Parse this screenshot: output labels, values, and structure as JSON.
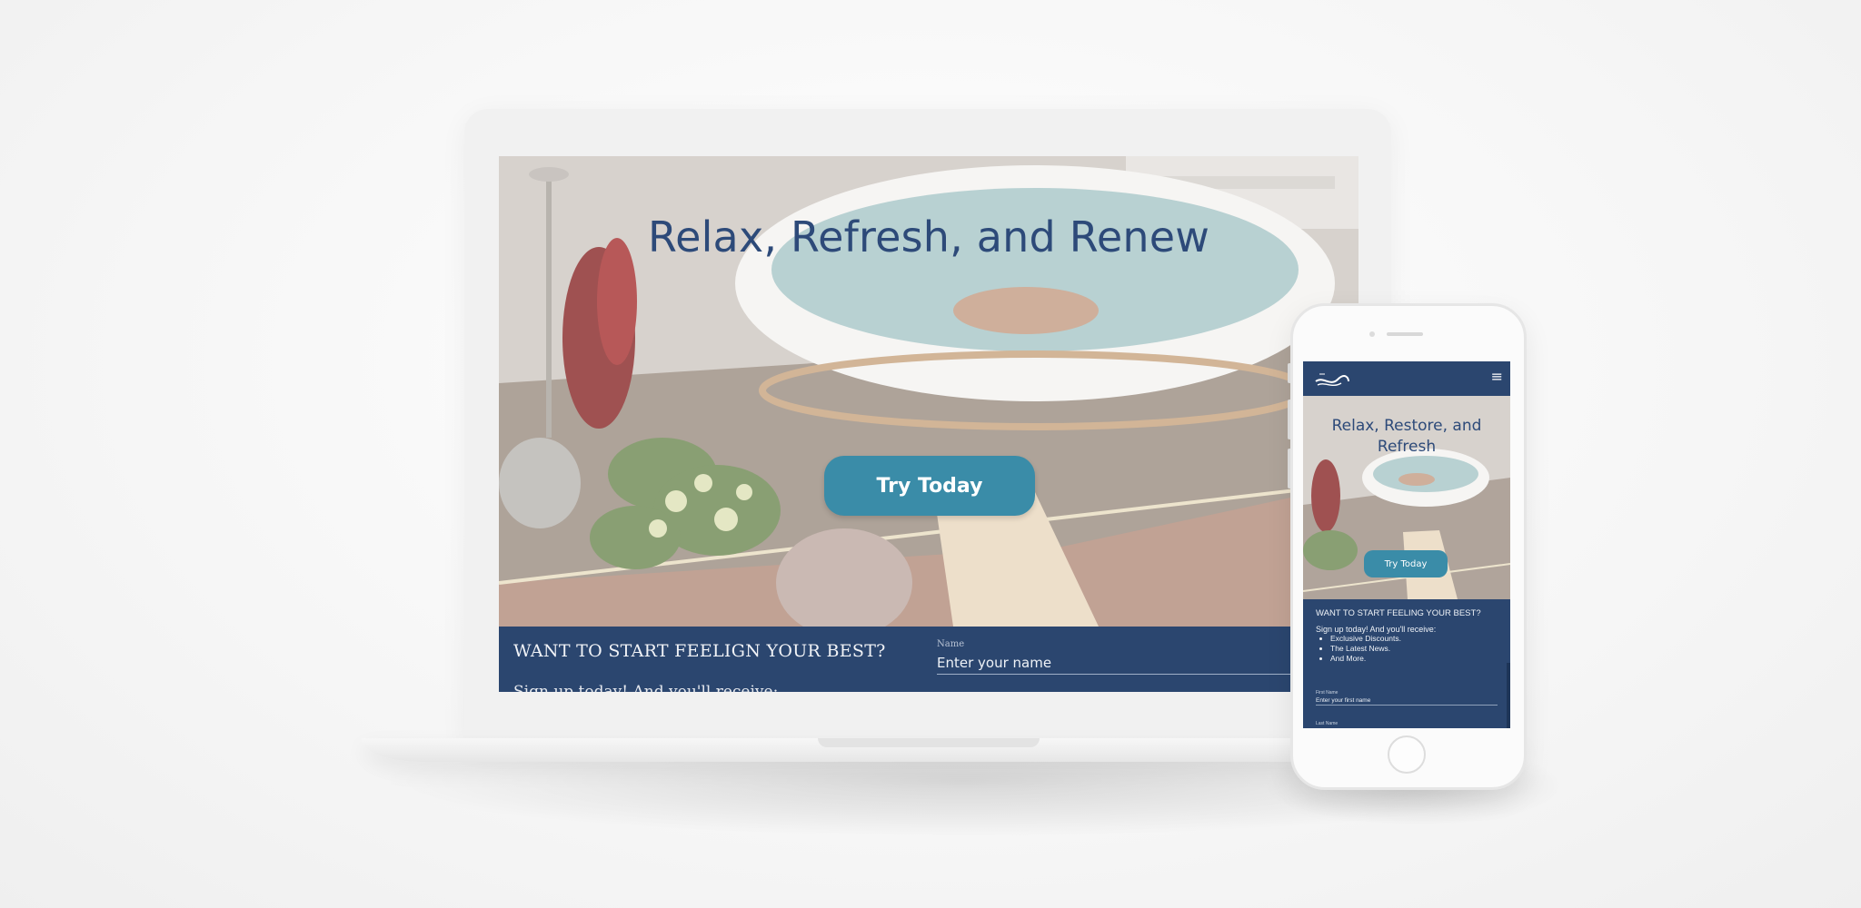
{
  "colors": {
    "brand_navy": "#2b466f",
    "accent_teal": "#3a8ca8",
    "hero_title": "#2d4a79"
  },
  "desktop": {
    "hero": {
      "title": "Relax, Refresh, and Renew",
      "cta_label": "Try Today"
    },
    "signup": {
      "heading": "WANT TO START FEELIGN YOUR BEST?",
      "subheading": "Sign up today! And you'll receive:",
      "name_label": "Name",
      "name_placeholder": "Enter your name"
    }
  },
  "mobile": {
    "menu_icon": "hamburger-icon",
    "hero": {
      "title": "Relax, Restore, and Refresh",
      "cta_label": "Try Today"
    },
    "signup": {
      "heading": "WANT TO START FEELING YOUR BEST?",
      "lead": "Sign up today! And you'll receive:",
      "benefits": [
        "Exclusive Discounts.",
        "The Latest News.",
        "And More."
      ],
      "first_name_label": "First Name",
      "first_name_placeholder": "Enter your first name",
      "last_name_label": "Last Name"
    }
  }
}
